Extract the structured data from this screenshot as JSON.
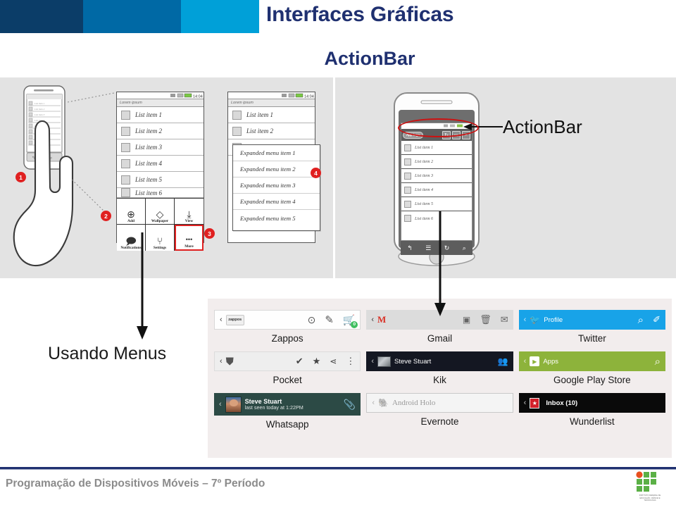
{
  "header": {
    "title_main": "Interfaces Gráficas",
    "title_sub": "ActionBar",
    "band_colors": [
      "#0b3d68",
      "#0069a5",
      "#00a0d8"
    ],
    "title_color": "#1f3070"
  },
  "diagram": {
    "left_panel": {
      "wireframe_a": {
        "app_title": "Lorem ipsum",
        "status_time": "14:04",
        "list_items": [
          "List item 1",
          "List item 2",
          "List item 3",
          "List item 4",
          "List item 5",
          "List item 6"
        ],
        "menu_grid": [
          {
            "icon": "add-icon",
            "glyph": "⊕",
            "label": "Add"
          },
          {
            "icon": "wallpaper-icon",
            "glyph": "◇",
            "label": "Wallpaper"
          },
          {
            "icon": "view-icon",
            "glyph": "⤓",
            "label": "View"
          },
          {
            "icon": "notifications-icon",
            "glyph": "🗩",
            "label": "Notifications"
          },
          {
            "icon": "settings-icon",
            "glyph": "⑂",
            "label": "Settings"
          },
          {
            "icon": "more-icon",
            "glyph": "•••",
            "label": "More"
          }
        ],
        "highlighted_cell_index": 5
      },
      "wireframe_b": {
        "app_title": "Lorem ipsum",
        "status_time": "14:04",
        "list_items": [
          "List item 1",
          "List item 2",
          "List item 3"
        ],
        "expanded_menu": [
          "Expanded menu item 1",
          "Expanded menu item 2",
          "Expanded menu item 3",
          "Expanded menu item 4",
          "Expanded menu item 5"
        ]
      },
      "mini_phone_items": [
        "List item 1",
        "List item 2",
        "List item 3",
        "List item 4",
        "List item 5",
        "List item 6",
        "List item 7",
        "List item 8"
      ],
      "badges": [
        "1",
        "2",
        "3",
        "4"
      ],
      "badge_color": "#e02020"
    },
    "right_panel": {
      "phone": {
        "app_logo_label": "App logo",
        "action_icons": [
          "refresh-icon",
          "chat-icon",
          "search-icon"
        ],
        "action_glyphs": [
          "↻",
          "🗨",
          "⌕"
        ],
        "list_items": [
          "List item 1",
          "List item 2",
          "List item 3",
          "List item 4",
          "List item 5",
          "List item 6"
        ],
        "nav_glyphs": [
          "↰",
          "☰",
          "↻",
          "⌕"
        ],
        "nav_icons": [
          "back-icon",
          "menu-icon",
          "refresh-icon",
          "search-icon"
        ]
      },
      "callout_label": "ActionBar",
      "highlight_color": "#cc1111"
    }
  },
  "left_caption": "Usando Menus",
  "showcase": {
    "background": "#f2eded",
    "apps": [
      {
        "name": "Zappos",
        "bar_class": "bar-zappos",
        "back_glyph": "‹",
        "brand_text": "zappos",
        "title": "",
        "actions": [
          {
            "icon": "play-circle-icon",
            "glyph": "⊙"
          },
          {
            "icon": "pencil-icon",
            "glyph": "✎"
          },
          {
            "icon": "cart-icon",
            "glyph": "🛒"
          }
        ],
        "cart_badge": "0"
      },
      {
        "name": "Gmail",
        "bar_class": "bar-gmail",
        "back_glyph": "‹",
        "brand_text": "M",
        "title": "",
        "actions": [
          {
            "icon": "archive-icon",
            "glyph": "▣"
          },
          {
            "icon": "trash-icon",
            "glyph": "🗑"
          },
          {
            "icon": "mail-icon",
            "glyph": "✉"
          }
        ]
      },
      {
        "name": "Twitter",
        "bar_class": "bar-twitter",
        "back_glyph": "‹",
        "brand_text": "🐦",
        "title": "Profile",
        "actions": [
          {
            "icon": "search-icon",
            "glyph": "⌕"
          },
          {
            "icon": "compose-icon",
            "glyph": "✐"
          }
        ]
      },
      {
        "name": "Pocket",
        "bar_class": "bar-pocket",
        "back_glyph": "‹",
        "brand_text": "▼",
        "title": "",
        "actions": [
          {
            "icon": "check-icon",
            "glyph": "✔"
          },
          {
            "icon": "star-icon",
            "glyph": "★"
          },
          {
            "icon": "share-icon",
            "glyph": "⋖"
          },
          {
            "icon": "overflow-menu-icon",
            "glyph": "⋮"
          }
        ]
      },
      {
        "name": "Kik",
        "bar_class": "bar-kik",
        "back_glyph": "‹",
        "brand_text": "",
        "title": "Steve Stuart",
        "actions": [
          {
            "icon": "people-icon",
            "glyph": "👥"
          }
        ]
      },
      {
        "name": "Google Play Store",
        "bar_class": "bar-play",
        "back_glyph": "‹",
        "brand_text": "▶",
        "title": "Apps",
        "actions": [
          {
            "icon": "search-icon",
            "glyph": "⌕"
          }
        ]
      },
      {
        "name": "Whatsapp",
        "bar_class": "bar-whats",
        "back_glyph": "‹",
        "brand_text": "",
        "title": "Steve Stuart",
        "subtitle": "last seen today at 1:22PM",
        "actions": [
          {
            "icon": "paperclip-icon",
            "glyph": "📎"
          }
        ]
      },
      {
        "name": "Evernote",
        "bar_class": "bar-ever",
        "back_glyph": "‹",
        "brand_text": "🐘",
        "title": "Android Holo",
        "actions": []
      },
      {
        "name": "Wunderlist",
        "bar_class": "bar-wunder",
        "back_glyph": "‹",
        "brand_text": "★",
        "title": "Inbox (10)",
        "actions": []
      }
    ]
  },
  "footer": {
    "text": "Programação de Dispositivos Móveis – 7º Período",
    "logo_name": "if-institute-logo",
    "logo_caption": "INSTITUTO FEDERAL DE EDUCAÇÃO, CIÊNCIA E TECNOLOGIA",
    "rule_color": "#1f3070"
  }
}
